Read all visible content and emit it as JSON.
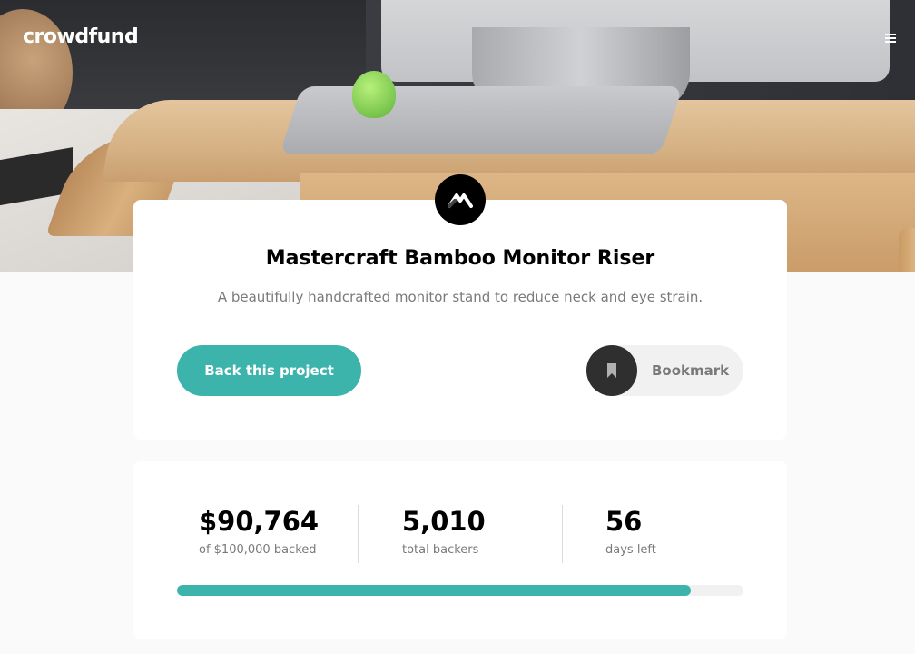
{
  "header": {
    "logo": "crowdfund",
    "menu_icon": "hamburger-menu-icon"
  },
  "project": {
    "logo_icon": "mastercraft-logo-icon",
    "title": "Mastercraft Bamboo Monitor Riser",
    "description": "A beautifully handcrafted monitor stand to reduce neck and eye strain.",
    "back_button_label": "Back this project",
    "bookmark_label": "Bookmark",
    "bookmark_icon": "bookmark-icon"
  },
  "stats": {
    "backed_amount": "$90,764",
    "backed_label": "of $100,000 backed",
    "backers_count": "5,010",
    "backers_label": "total backers",
    "days_left": "56",
    "days_label": "days left",
    "progress_fraction": 0.90764
  },
  "colors": {
    "accent": "#3cb4ac",
    "dark": "#2f2f2f",
    "muted_text": "#7a7a7a"
  }
}
